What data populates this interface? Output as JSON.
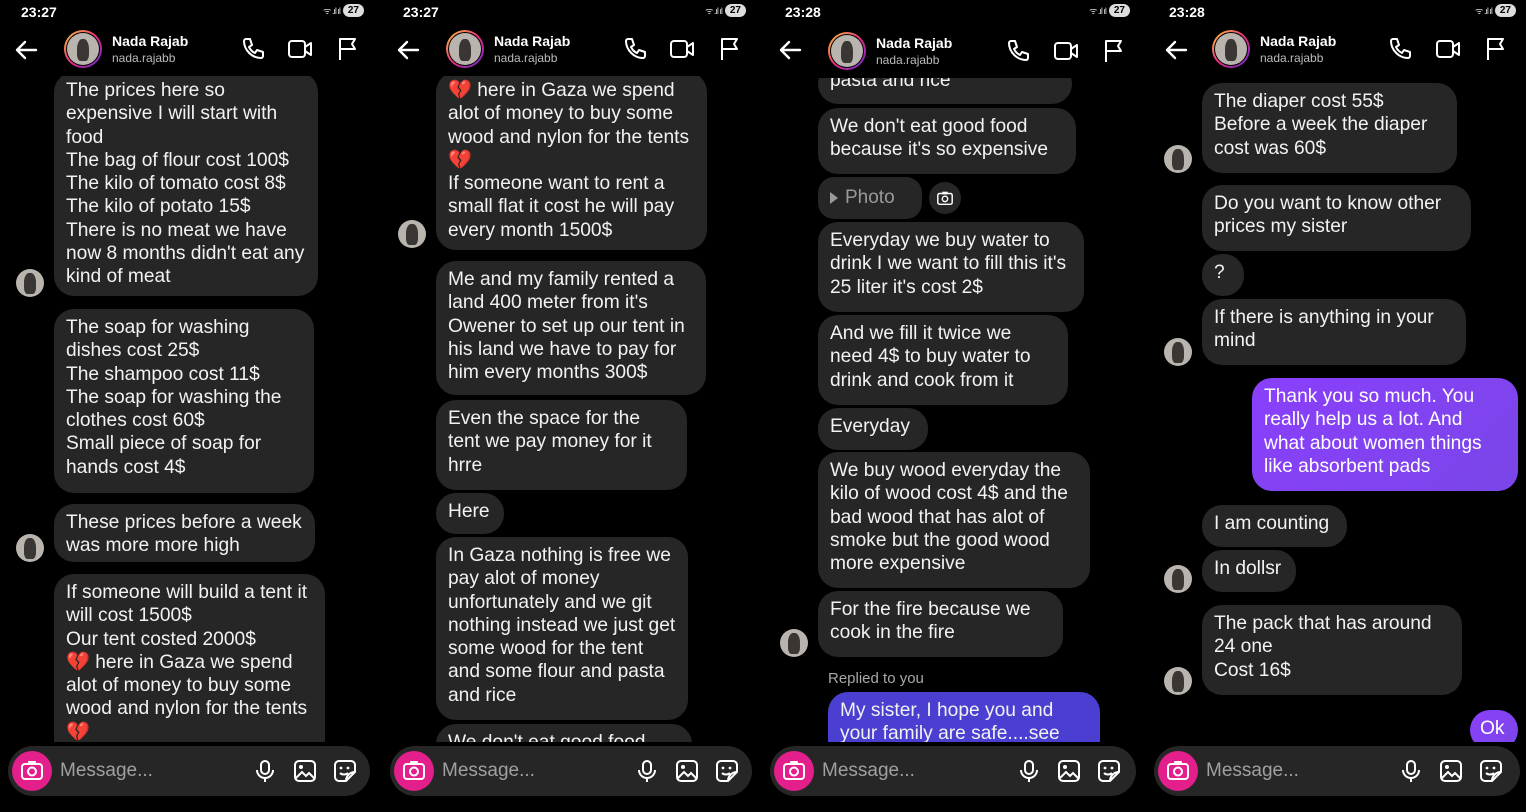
{
  "contact": {
    "name": "Nada Rajab",
    "username": "nada.rajabb"
  },
  "composer": {
    "placeholder": "Message..."
  },
  "battery": "27",
  "icons": [
    "back-arrow-icon",
    "phone-icon",
    "video-camera-icon",
    "flag-icon",
    "camera-icon",
    "microphone-icon",
    "image-icon",
    "sticker-icon"
  ],
  "panels": [
    {
      "time": "23:27",
      "messages": [
        "The prices here so expensive I will start with food\nThe bag of flour cost 100$\nThe kilo of tomato cost 8$\nThe kilo of potato 15$\nThere is no meat we have now 8 months didn't eat any kind of meat",
        "The soap for washing dishes cost 25$\nThe shampoo cost 11$\nThe soap for washing the clothes cost 60$\nSmall piece of soap for hands cost 4$",
        "These prices before a week was more more high",
        "If someone will build a tent it will cost 1500$\nOur tent costed 2000$\n💔 here in Gaza we spend alot of money to buy some wood and nylon for the tents 💔"
      ]
    },
    {
      "time": "23:27",
      "messages": [
        "💔 here in Gaza we spend alot of money to buy some wood and nylon for the tents 💔\nIf someone want to rent a small flat it cost he will pay every month 1500$",
        "Me and my family rented a land 400 meter from it's Owener to set up our tent in his land we have to pay for him every months 300$",
        "Even the space for the tent we pay money for it hrre",
        "Here",
        "In Gaza nothing is free we pay alot of money unfortunately and we git nothing instead we just get some wood for the tent and some flour and pasta and rice",
        "We don't eat good food"
      ]
    },
    {
      "time": "23:28",
      "messages": [
        "pasta and rice",
        "We don't eat good food because it's so expensive",
        "Photo",
        "Everyday we buy water to drink I we want to fill this it's 25 liter it's cost 2$",
        "And we fill it twice we need 4$ to buy water to drink and cook from it",
        "Everyday",
        "We buy wood everyday the kilo of wood cost 4$ and the bad wood that has alot of smoke but the good wood more expensive",
        "For the fire because we cook in the fire",
        "Replied to you",
        "My sister, I hope you and your family are safe....see more"
      ]
    },
    {
      "time": "23:28",
      "messages": [
        "The diaper cost 55$\nBefore a week the diaper cost was 60$",
        "Do you want to know other prices my sister",
        "?",
        "If there is anything in your mind",
        "Thank you so much. You really help us a lot. And what about women things like absorbent pads",
        "I am counting",
        "In dollsr",
        "The pack that has around 24 one\nCost 16$",
        "Ok"
      ]
    }
  ]
}
